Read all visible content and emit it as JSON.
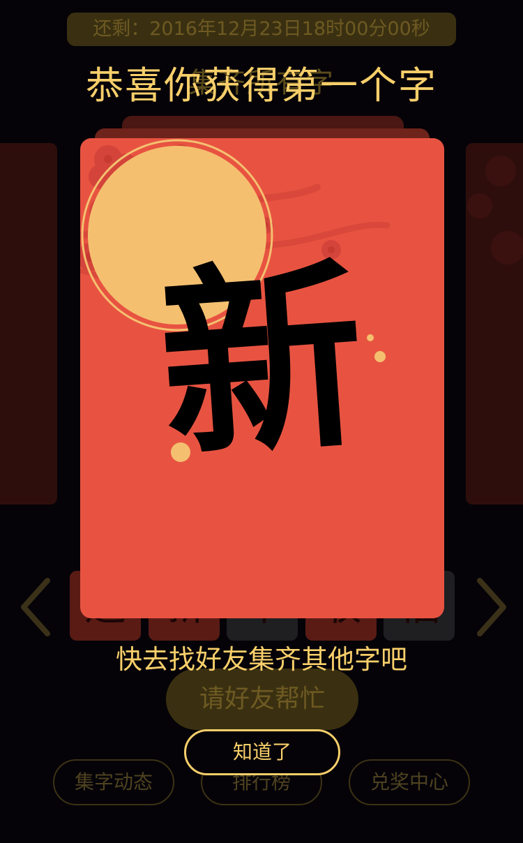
{
  "countdown": {
    "text": "还剩：2016年12月23日18时00分00秒"
  },
  "background": {
    "subtitle": "集齐所有字",
    "thumbs": [
      "迎",
      "新",
      "年",
      "收",
      "福"
    ],
    "help_button": "请好友帮忙",
    "nav_buttons": [
      "集字动态",
      "排行榜",
      "兑奖中心"
    ]
  },
  "modal": {
    "title": "恭喜你获得第一个字",
    "character": "新",
    "hint": "快去找好友集齐其他字吧",
    "ok_button": "知道了"
  },
  "colors": {
    "accent_gold": "#f8cf6a",
    "card_red": "#e85341",
    "circle_gold": "#f4c070",
    "background": "#050308"
  }
}
